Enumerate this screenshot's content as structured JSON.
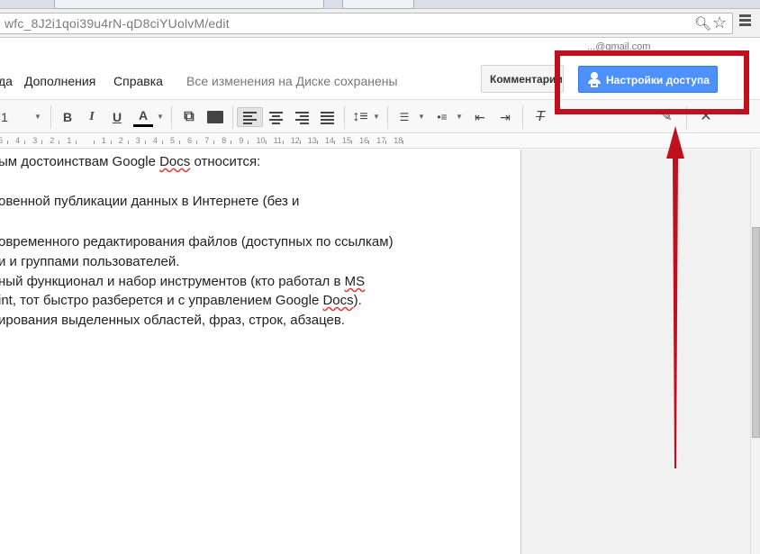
{
  "browser": {
    "url": "wfc_8J2i1qoi39u4rN-qD8ciYUolvM/edit",
    "zoom_icon": "magnifier-plus-icon",
    "bookmark_icon": "star-outline-icon",
    "menu_icon": "hamburger-menu-icon"
  },
  "header": {
    "account_email_fragment": "...@gmail.com",
    "menu": [
      "да",
      "Дополнения",
      "Справка"
    ],
    "save_status": "Все изменения на Диске сохранены",
    "comments_label": "Комментарии",
    "share_label": "Настройки доступа",
    "share_color": "#4d90fe"
  },
  "toolbar": {
    "font_size": "1",
    "bold": "B",
    "italic": "I",
    "underline": "U",
    "text_color": "A",
    "link_icon": "link-icon",
    "comment_icon": "comment-icon",
    "align_left_active": true,
    "line_spacing_icon": "line-spacing-icon",
    "numbered_list_icon": "numbered-list-icon",
    "bulleted_list_icon": "bulleted-list-icon",
    "decrease_indent_icon": "decrease-indent-icon",
    "increase_indent_icon": "increase-indent-icon",
    "clear_format_icon": "clear-formatting-icon",
    "pencil_icon": "pencil-icon",
    "close_icon": "close-icon"
  },
  "ruler": {
    "labels": [
      "5",
      "4",
      "3",
      "2",
      "1",
      "",
      "1",
      "2",
      "3",
      "4",
      "5",
      "6",
      "7",
      "8",
      "9",
      "10",
      "11",
      "12",
      "13",
      "14",
      "15",
      "16",
      "17",
      "18"
    ]
  },
  "document": {
    "lines": [
      {
        "pre": "ым достоинствам Google ",
        "squig": "Docs",
        "post": " относится:"
      },
      {
        "pre": "",
        "squig": "",
        "post": ""
      },
      {
        "pre": "овенной публикации данных в Интернете (без и",
        "squig": "",
        "post": ""
      },
      {
        "pre": "",
        "squig": "",
        "post": ""
      },
      {
        "pre": "овременного редактирования файлов (доступных по ссылкам)",
        "squig": "",
        "post": ""
      },
      {
        "pre": "и и группами пользователей.",
        "squig": "",
        "post": ""
      },
      {
        "pre": "ный функционал и набор инструментов (кто работал в ",
        "squig": "MS",
        "post": ""
      },
      {
        "pre": "int, тот быстро разберется и с управлением Google ",
        "squig": "Docs",
        "post": ")."
      },
      {
        "pre": "ирования выделенных областей, фраз, строк, абзацев.",
        "squig": "",
        "post": ""
      }
    ]
  },
  "annotation": {
    "color": "#c0101d",
    "arrow_target": "share-button"
  }
}
